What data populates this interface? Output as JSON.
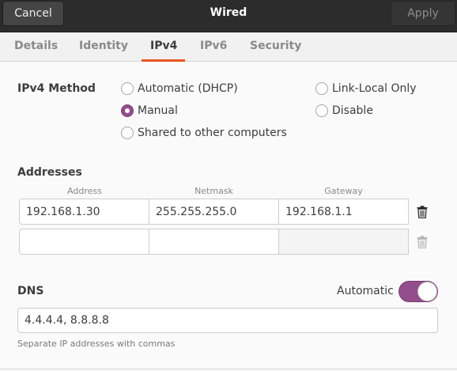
{
  "header": {
    "cancel_label": "Cancel",
    "title": "Wired",
    "apply_label": "Apply"
  },
  "tabs": [
    {
      "label": "Details"
    },
    {
      "label": "Identity"
    },
    {
      "label": "IPv4"
    },
    {
      "label": "IPv6"
    },
    {
      "label": "Security"
    }
  ],
  "active_tab": "IPv4",
  "ipv4_method": {
    "label": "IPv4 Method",
    "options": [
      {
        "label": "Automatic (DHCP)",
        "selected": false
      },
      {
        "label": "Manual",
        "selected": true
      },
      {
        "label": "Shared to other computers",
        "selected": false
      },
      {
        "label": "Link-Local Only",
        "selected": false
      },
      {
        "label": "Disable",
        "selected": false
      }
    ]
  },
  "addresses": {
    "label": "Addresses",
    "columns": [
      "Address",
      "Netmask",
      "Gateway"
    ],
    "rows": [
      {
        "address": "192.168.1.30",
        "netmask": "255.255.255.0",
        "gateway": "192.168.1.1"
      },
      {
        "address": "",
        "netmask": "",
        "gateway": ""
      }
    ]
  },
  "dns": {
    "label": "DNS",
    "automatic_label": "Automatic",
    "automatic_on": true,
    "value": "4.4.4.4, 8.8.8.8",
    "hint": "Separate IP addresses with commas"
  },
  "colors": {
    "accent": "#924d8b",
    "tab_underline": "#e95420",
    "header_bg": "#2c2c2c"
  },
  "icons": {
    "delete_row": "trash-icon"
  }
}
